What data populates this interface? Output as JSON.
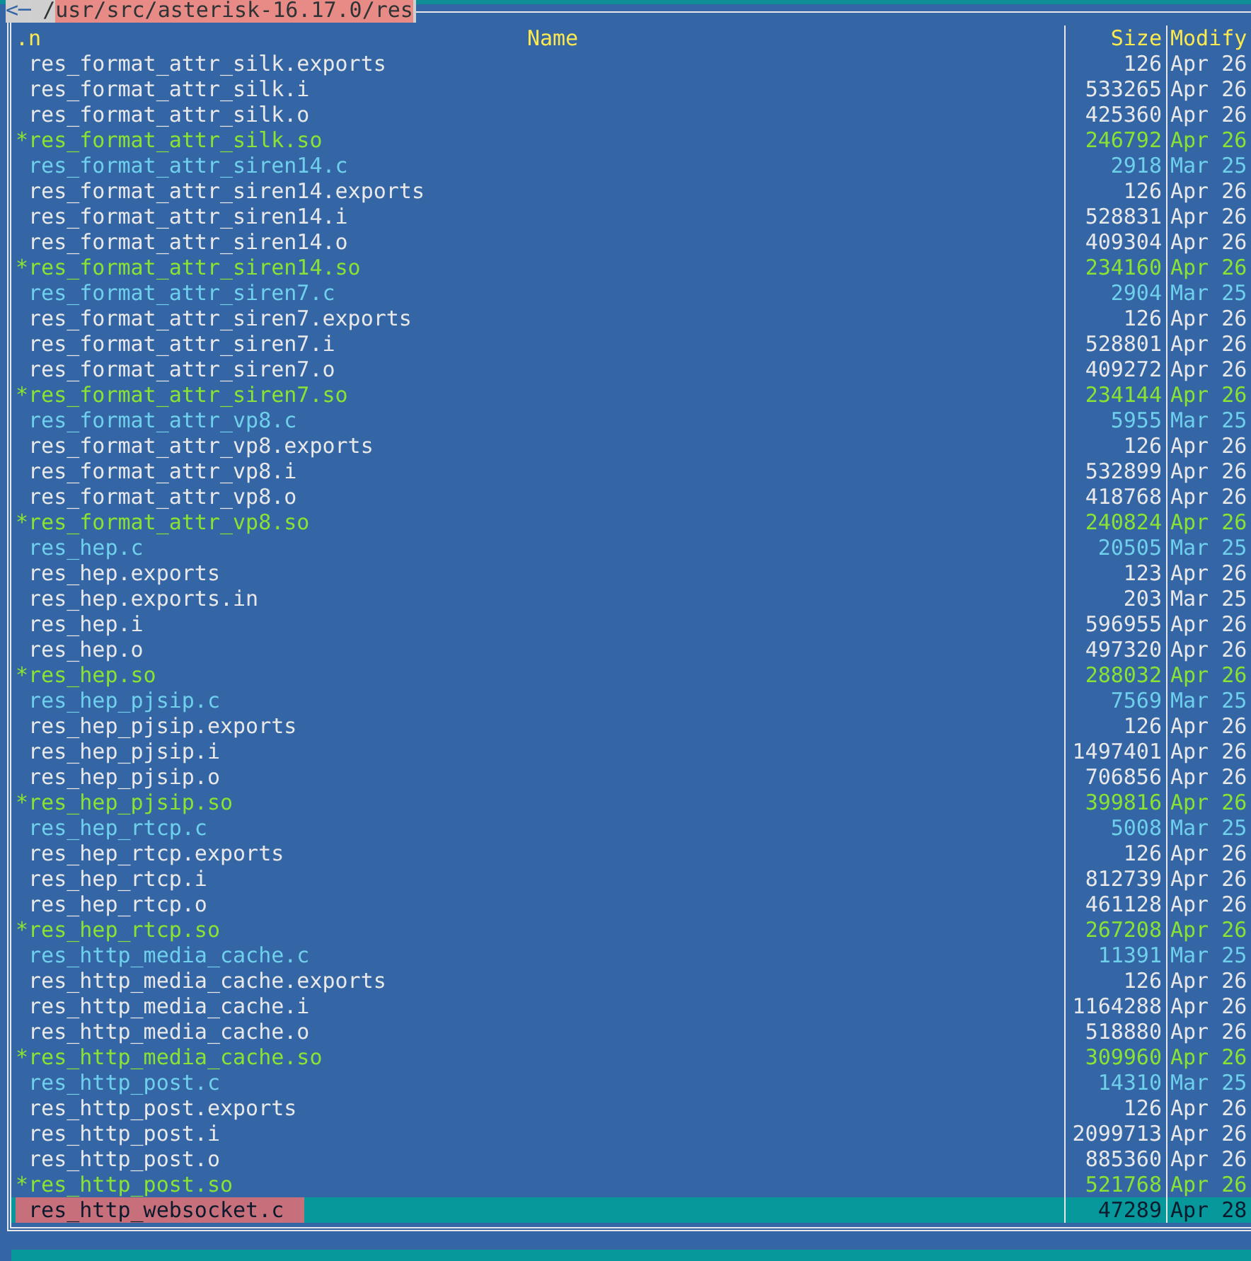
{
  "panel": {
    "path_prefix": "/",
    "path": "usr/src/asterisk-16.17.0/res",
    "back_arrow": "<─"
  },
  "columns": [
    {
      "label": ".n"
    },
    {
      "label": "Name"
    },
    {
      "label": "Size"
    },
    {
      "label": "Modify"
    }
  ],
  "rows": [
    {
      "name": " res_format_attr_silk.exports",
      "size": "126",
      "modified": "Apr 26",
      "kind": "file",
      "selected": false
    },
    {
      "name": " res_format_attr_silk.i",
      "size": "533265",
      "modified": "Apr 26",
      "kind": "file",
      "selected": false
    },
    {
      "name": " res_format_attr_silk.o",
      "size": "425360",
      "modified": "Apr 26",
      "kind": "file",
      "selected": false
    },
    {
      "name": "*res_format_attr_silk.so",
      "size": "246792",
      "modified": "Apr 26",
      "kind": "executable",
      "selected": false
    },
    {
      "name": " res_format_attr_siren14.c",
      "size": "2918",
      "modified": "Mar 25",
      "kind": "source",
      "selected": false
    },
    {
      "name": " res_format_attr_siren14.exports",
      "size": "126",
      "modified": "Apr 26",
      "kind": "file",
      "selected": false
    },
    {
      "name": " res_format_attr_siren14.i",
      "size": "528831",
      "modified": "Apr 26",
      "kind": "file",
      "selected": false
    },
    {
      "name": " res_format_attr_siren14.o",
      "size": "409304",
      "modified": "Apr 26",
      "kind": "file",
      "selected": false
    },
    {
      "name": "*res_format_attr_siren14.so",
      "size": "234160",
      "modified": "Apr 26",
      "kind": "executable",
      "selected": false
    },
    {
      "name": " res_format_attr_siren7.c",
      "size": "2904",
      "modified": "Mar 25",
      "kind": "source",
      "selected": false
    },
    {
      "name": " res_format_attr_siren7.exports",
      "size": "126",
      "modified": "Apr 26",
      "kind": "file",
      "selected": false
    },
    {
      "name": " res_format_attr_siren7.i",
      "size": "528801",
      "modified": "Apr 26",
      "kind": "file",
      "selected": false
    },
    {
      "name": " res_format_attr_siren7.o",
      "size": "409272",
      "modified": "Apr 26",
      "kind": "file",
      "selected": false
    },
    {
      "name": "*res_format_attr_siren7.so",
      "size": "234144",
      "modified": "Apr 26",
      "kind": "executable",
      "selected": false
    },
    {
      "name": " res_format_attr_vp8.c",
      "size": "5955",
      "modified": "Mar 25",
      "kind": "source",
      "selected": false
    },
    {
      "name": " res_format_attr_vp8.exports",
      "size": "126",
      "modified": "Apr 26",
      "kind": "file",
      "selected": false
    },
    {
      "name": " res_format_attr_vp8.i",
      "size": "532899",
      "modified": "Apr 26",
      "kind": "file",
      "selected": false
    },
    {
      "name": " res_format_attr_vp8.o",
      "size": "418768",
      "modified": "Apr 26",
      "kind": "file",
      "selected": false
    },
    {
      "name": "*res_format_attr_vp8.so",
      "size": "240824",
      "modified": "Apr 26",
      "kind": "executable",
      "selected": false
    },
    {
      "name": " res_hep.c",
      "size": "20505",
      "modified": "Mar 25",
      "kind": "source",
      "selected": false
    },
    {
      "name": " res_hep.exports",
      "size": "123",
      "modified": "Apr 26",
      "kind": "file",
      "selected": false
    },
    {
      "name": " res_hep.exports.in",
      "size": "203",
      "modified": "Mar 25",
      "kind": "file",
      "selected": false
    },
    {
      "name": " res_hep.i",
      "size": "596955",
      "modified": "Apr 26",
      "kind": "file",
      "selected": false
    },
    {
      "name": " res_hep.o",
      "size": "497320",
      "modified": "Apr 26",
      "kind": "file",
      "selected": false
    },
    {
      "name": "*res_hep.so",
      "size": "288032",
      "modified": "Apr 26",
      "kind": "executable",
      "selected": false
    },
    {
      "name": " res_hep_pjsip.c",
      "size": "7569",
      "modified": "Mar 25",
      "kind": "source",
      "selected": false
    },
    {
      "name": " res_hep_pjsip.exports",
      "size": "126",
      "modified": "Apr 26",
      "kind": "file",
      "selected": false
    },
    {
      "name": " res_hep_pjsip.i",
      "size": "1497401",
      "modified": "Apr 26",
      "kind": "file",
      "selected": false
    },
    {
      "name": " res_hep_pjsip.o",
      "size": "706856",
      "modified": "Apr 26",
      "kind": "file",
      "selected": false
    },
    {
      "name": "*res_hep_pjsip.so",
      "size": "399816",
      "modified": "Apr 26",
      "kind": "executable",
      "selected": false
    },
    {
      "name": " res_hep_rtcp.c",
      "size": "5008",
      "modified": "Mar 25",
      "kind": "source",
      "selected": false
    },
    {
      "name": " res_hep_rtcp.exports",
      "size": "126",
      "modified": "Apr 26",
      "kind": "file",
      "selected": false
    },
    {
      "name": " res_hep_rtcp.i",
      "size": "812739",
      "modified": "Apr 26",
      "kind": "file",
      "selected": false
    },
    {
      "name": " res_hep_rtcp.o",
      "size": "461128",
      "modified": "Apr 26",
      "kind": "file",
      "selected": false
    },
    {
      "name": "*res_hep_rtcp.so",
      "size": "267208",
      "modified": "Apr 26",
      "kind": "executable",
      "selected": false
    },
    {
      "name": " res_http_media_cache.c",
      "size": "11391",
      "modified": "Mar 25",
      "kind": "source",
      "selected": false
    },
    {
      "name": " res_http_media_cache.exports",
      "size": "126",
      "modified": "Apr 26",
      "kind": "file",
      "selected": false
    },
    {
      "name": " res_http_media_cache.i",
      "size": "1164288",
      "modified": "Apr 26",
      "kind": "file",
      "selected": false
    },
    {
      "name": " res_http_media_cache.o",
      "size": "518880",
      "modified": "Apr 26",
      "kind": "file",
      "selected": false
    },
    {
      "name": "*res_http_media_cache.so",
      "size": "309960",
      "modified": "Apr 26",
      "kind": "executable",
      "selected": false
    },
    {
      "name": " res_http_post.c",
      "size": "14310",
      "modified": "Mar 25",
      "kind": "source",
      "selected": false
    },
    {
      "name": " res_http_post.exports",
      "size": "126",
      "modified": "Apr 26",
      "kind": "file",
      "selected": false
    },
    {
      "name": " res_http_post.i",
      "size": "2099713",
      "modified": "Apr 26",
      "kind": "file",
      "selected": false
    },
    {
      "name": " res_http_post.o",
      "size": "885360",
      "modified": "Apr 26",
      "kind": "file",
      "selected": false
    },
    {
      "name": "*res_http_post.so",
      "size": "521768",
      "modified": "Apr 26",
      "kind": "executable",
      "selected": false
    },
    {
      "name": " res_http_websocket.c",
      "size": "47289",
      "modified": "Apr 28",
      "kind": "source",
      "selected": true
    }
  ]
}
